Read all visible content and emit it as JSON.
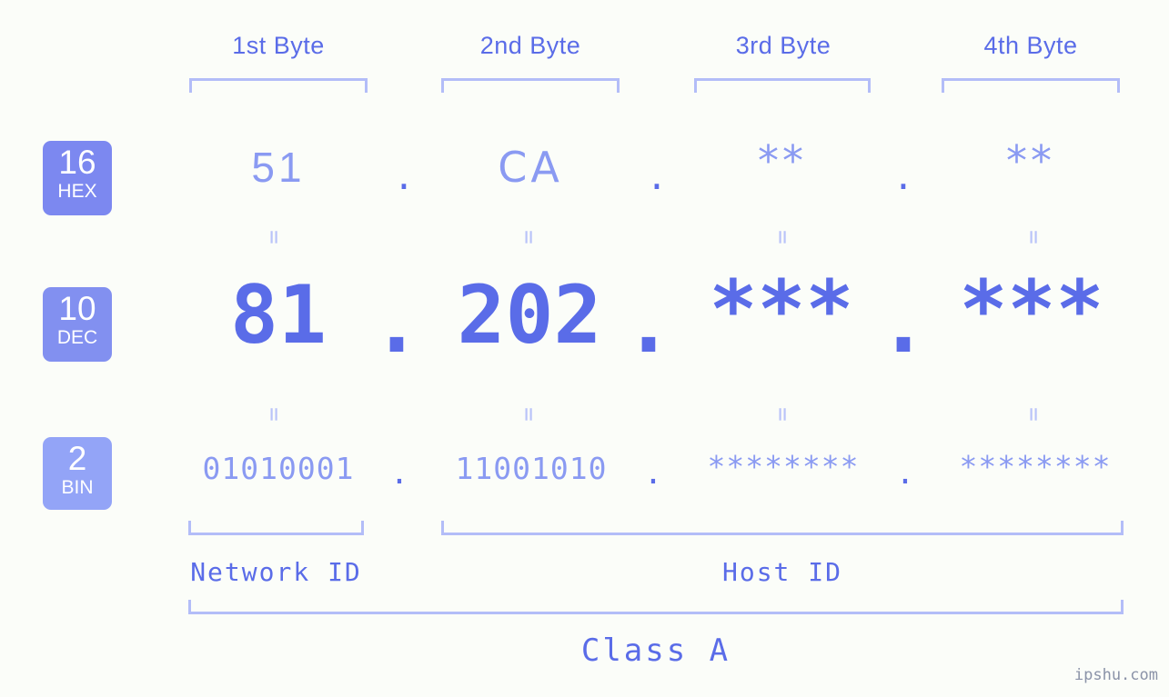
{
  "background_color": "#fbfdf9",
  "accent_color": "#5a6ce8",
  "light_accent_color": "#8a9af2",
  "bracket_color": "#b3bdf8",
  "headers": [
    {
      "label": "1st Byte"
    },
    {
      "label": "2nd Byte"
    },
    {
      "label": "3rd Byte"
    },
    {
      "label": "4th Byte"
    }
  ],
  "bases": [
    {
      "number": "16",
      "tag": "HEX",
      "color": "#7c88f0"
    },
    {
      "number": "10",
      "tag": "DEC",
      "color": "#8290f0"
    },
    {
      "number": "2",
      "tag": "BIN",
      "color": "#93a4f7"
    }
  ],
  "rows": {
    "hex": {
      "values": [
        "51",
        "CA",
        "**",
        "**"
      ],
      "separator": "."
    },
    "dec": {
      "values": [
        "81",
        "202",
        "***",
        "***"
      ],
      "separator": "."
    },
    "bin": {
      "values": [
        "01010001",
        "11001010",
        "********",
        "********"
      ],
      "separator": "."
    }
  },
  "equals_glyph": "=",
  "segments": {
    "network_id": "Network ID",
    "host_id": "Host ID",
    "ip_class": "Class A"
  },
  "watermark": "ipshu.com"
}
